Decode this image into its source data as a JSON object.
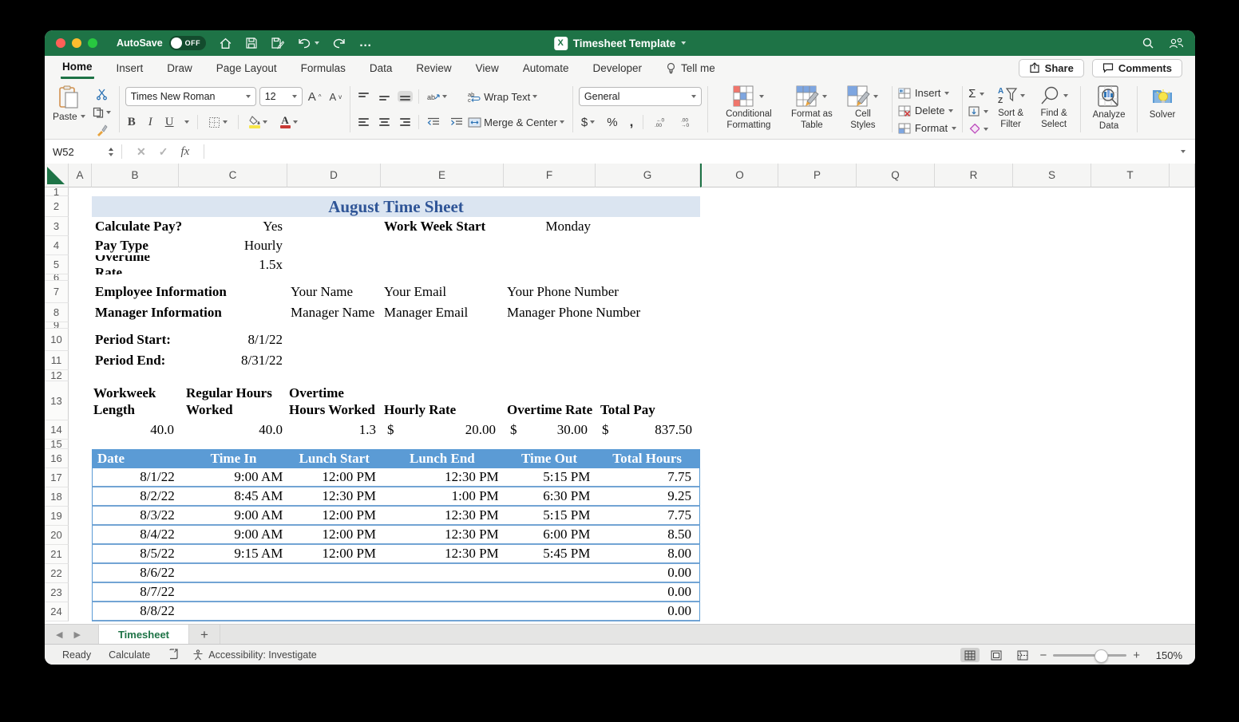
{
  "titlebar": {
    "autosave_label": "AutoSave",
    "autosave_state": "OFF",
    "title": "Timesheet Template"
  },
  "tabs": {
    "items": [
      "Home",
      "Insert",
      "Draw",
      "Page Layout",
      "Formulas",
      "Data",
      "Review",
      "View",
      "Automate",
      "Developer",
      "Tell me"
    ],
    "active": "Home"
  },
  "actions": {
    "share": "Share",
    "comments": "Comments"
  },
  "ribbon": {
    "paste": "Paste",
    "font_name": "Times New Roman",
    "font_size": "12",
    "wrap_text": "Wrap Text",
    "merge_center": "Merge & Center",
    "number_format": "General",
    "conditional_formatting": "Conditional Formatting",
    "format_as_table": "Format as Table",
    "cell_styles": "Cell Styles",
    "insert": "Insert",
    "delete": "Delete",
    "format": "Format",
    "sort_filter": "Sort & Filter",
    "find_select": "Find & Select",
    "analyze_data": "Analyze Data",
    "solver": "Solver"
  },
  "formula_bar": {
    "cell_ref": "W52"
  },
  "grid": {
    "columns": [
      "A",
      "B",
      "C",
      "D",
      "E",
      "F",
      "G",
      "O",
      "P",
      "Q",
      "R",
      "S",
      "T"
    ],
    "rows": [
      "1",
      "2",
      "3",
      "4",
      "5",
      "6",
      "7",
      "8",
      "9",
      "10",
      "11",
      "12",
      "13",
      "14",
      "15",
      "16",
      "17",
      "18",
      "19",
      "20",
      "21",
      "22",
      "23",
      "24"
    ]
  },
  "sheet": {
    "title": "August Time Sheet",
    "settings": {
      "calculate_pay_label": "Calculate Pay?",
      "calculate_pay": "Yes",
      "work_week_start_label": "Work Week Start",
      "work_week_start": "Monday",
      "pay_type_label": "Pay Type",
      "pay_type": "Hourly",
      "overtime_rate_label": "Overtime Rate",
      "overtime_rate": "1.5x"
    },
    "info": {
      "employee_label": "Employee Information",
      "employee_name": "Your Name",
      "employee_email": "Your Email",
      "employee_phone": "Your Phone Number",
      "manager_label": "Manager Information",
      "manager_name": "Manager Name",
      "manager_email": "Manager Email",
      "manager_phone": "Manager Phone Number"
    },
    "period": {
      "start_label": "Period Start:",
      "start": "8/1/22",
      "end_label": "Period End:",
      "end": "8/31/22"
    },
    "summary": {
      "h_workweek": "Workweek Length",
      "h_regular": "Regular Hours Worked",
      "h_overtime_hours": "Overtime Hours Worked",
      "h_hourly_rate": "Hourly Rate",
      "h_overtime_rate": "Overtime Rate",
      "h_total_pay": "Total Pay",
      "workweek_length": "40.0",
      "regular_hours": "40.0",
      "overtime_hours": "1.3",
      "currency": "$",
      "hourly_rate": "20.00",
      "overtime_rate": "30.00",
      "total_pay": "837.50"
    },
    "table": {
      "headers": [
        "Date",
        "Time In",
        "Lunch Start",
        "Lunch End",
        "Time Out",
        "Total Hours"
      ],
      "rows": [
        {
          "date": "8/1/22",
          "time_in": "9:00 AM",
          "lunch_start": "12:00 PM",
          "lunch_end": "12:30 PM",
          "time_out": "5:15 PM",
          "total": "7.75"
        },
        {
          "date": "8/2/22",
          "time_in": "8:45 AM",
          "lunch_start": "12:30 PM",
          "lunch_end": "1:00 PM",
          "time_out": "6:30 PM",
          "total": "9.25"
        },
        {
          "date": "8/3/22",
          "time_in": "9:00 AM",
          "lunch_start": "12:00 PM",
          "lunch_end": "12:30 PM",
          "time_out": "5:15 PM",
          "total": "7.75"
        },
        {
          "date": "8/4/22",
          "time_in": "9:00 AM",
          "lunch_start": "12:00 PM",
          "lunch_end": "12:30 PM",
          "time_out": "6:00 PM",
          "total": "8.50"
        },
        {
          "date": "8/5/22",
          "time_in": "9:15 AM",
          "lunch_start": "12:00 PM",
          "lunch_end": "12:30 PM",
          "time_out": "5:45 PM",
          "total": "8.00"
        },
        {
          "date": "8/6/22",
          "time_in": "",
          "lunch_start": "",
          "lunch_end": "",
          "time_out": "",
          "total": "0.00"
        },
        {
          "date": "8/7/22",
          "time_in": "",
          "lunch_start": "",
          "lunch_end": "",
          "time_out": "",
          "total": "0.00"
        },
        {
          "date": "8/8/22",
          "time_in": "",
          "lunch_start": "",
          "lunch_end": "",
          "time_out": "",
          "total": "0.00"
        }
      ]
    }
  },
  "sheet_tabs": {
    "active": "Timesheet",
    "add": "+"
  },
  "status_bar": {
    "ready": "Ready",
    "calculate": "Calculate",
    "accessibility": "Accessibility: Investigate",
    "zoom": "150%"
  },
  "colors": {
    "titlebar_green": "#1E7346",
    "table_header_blue": "#5B9BD5",
    "sheet_title_text": "#2F5597",
    "sheet_title_bg": "#DBE5F1"
  }
}
